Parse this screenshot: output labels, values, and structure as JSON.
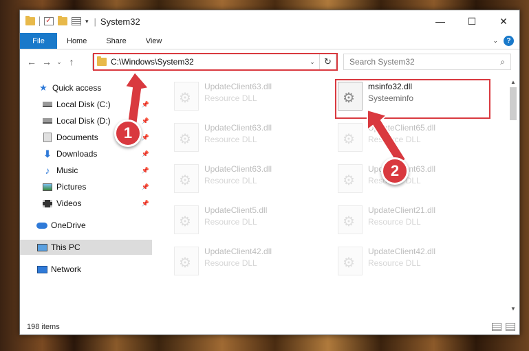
{
  "window": {
    "title": "System32"
  },
  "caption": {
    "minimize": "—",
    "maximize": "☐",
    "close": "✕"
  },
  "ribbon": {
    "tabs": [
      {
        "label": "File"
      },
      {
        "label": "Home"
      },
      {
        "label": "Share"
      },
      {
        "label": "View"
      }
    ],
    "expand": "⌄",
    "help": "?"
  },
  "nav": {
    "back": "←",
    "forward": "→",
    "recent": "⌄",
    "up": "↑",
    "address": "C:\\Windows\\System32",
    "address_drop": "⌄",
    "refresh": "↻",
    "search_placeholder": "Search System32",
    "search_icon": "⌕"
  },
  "sidebar": {
    "items": [
      {
        "label": "Quick access",
        "icon": "star-icon"
      },
      {
        "label": "Local Disk (C:)",
        "icon": "drive-icon",
        "pinned": true
      },
      {
        "label": "Local Disk (D:)",
        "icon": "drive-icon",
        "pinned": true
      },
      {
        "label": "Documents",
        "icon": "document-icon",
        "pinned": true
      },
      {
        "label": "Downloads",
        "icon": "download-icon",
        "pinned": true
      },
      {
        "label": "Music",
        "icon": "music-icon",
        "pinned": true
      },
      {
        "label": "Pictures",
        "icon": "pictures-icon",
        "pinned": true
      },
      {
        "label": "Videos",
        "icon": "videos-icon",
        "pinned": true
      },
      {
        "label": "OneDrive",
        "icon": "cloud-icon"
      },
      {
        "label": "This PC",
        "icon": "computer-icon",
        "selected": true
      },
      {
        "label": "Network",
        "icon": "network-icon"
      }
    ],
    "pin_glyph": "📌"
  },
  "files": [
    {
      "name": "UpdateClient63.dll",
      "desc": "Resource DLL"
    },
    {
      "name": "msinfo32.dll",
      "desc": "Systeeminfo"
    },
    {
      "name": "UpdateClient63.dll",
      "desc": "Resource DLL"
    },
    {
      "name": "UpdateClient65.dll",
      "desc": "Resource DLL"
    },
    {
      "name": "UpdateClient63.dll",
      "desc": "Resource DLL"
    },
    {
      "name": "UpdateClient63.dll",
      "desc": "Resource DLL"
    },
    {
      "name": "UpdateClient5.dll",
      "desc": "Resource DLL"
    },
    {
      "name": "UpdateClient21.dll",
      "desc": "Resource DLL"
    },
    {
      "name": "UpdateClient42.dll",
      "desc": "Resource DLL"
    },
    {
      "name": "UpdateClient42.dll",
      "desc": "Resource DLL"
    }
  ],
  "status": {
    "count": "198 items"
  },
  "callouts": {
    "one": "1",
    "two": "2"
  },
  "colors": {
    "accent": "#1979ca",
    "highlight": "#d9393f"
  }
}
